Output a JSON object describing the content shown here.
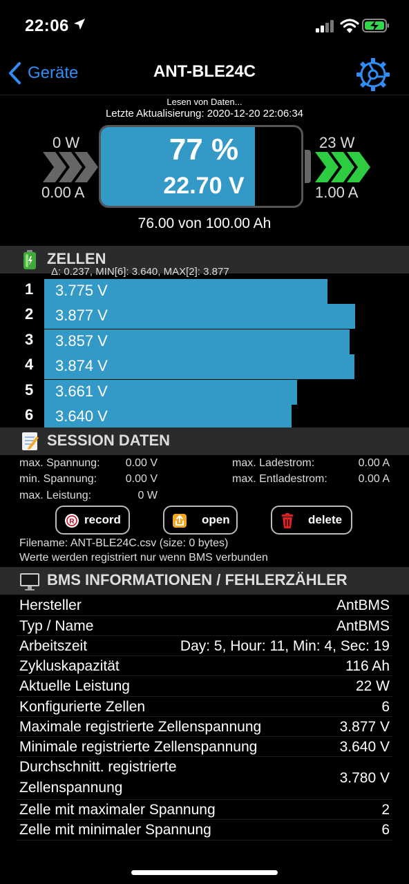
{
  "status_bar": {
    "time": "22:06"
  },
  "nav": {
    "back_label": "Geräte",
    "title": "ANT-BLE24C"
  },
  "battery": {
    "status": "Lesen von Daten...",
    "last_update": "Letzte Aktualisierung: 2020-12-20 22:06:34",
    "in_watts": "0 W",
    "in_amps": "0.00 A",
    "out_watts": "23 W",
    "out_amps": "1.00 A",
    "soc": "77 %",
    "soc_fraction": 0.77,
    "voltage": "22.70 V",
    "capacity": "76.00 von 100.00 Ah",
    "colors": {
      "fill": "#3399c6",
      "arrow_active": "#2ecc40",
      "arrow_inactive": "#666666"
    }
  },
  "cells": {
    "title": "ZELLEN",
    "summary": "Δ: 0.237, MIN[6]: 3.640, MAX[2]: 3.877",
    "items": [
      {
        "index": "1",
        "value": "3.775 V",
        "voltage": 3.775
      },
      {
        "index": "2",
        "value": "3.877 V",
        "voltage": 3.877
      },
      {
        "index": "3",
        "value": "3.857 V",
        "voltage": 3.857
      },
      {
        "index": "4",
        "value": "3.874 V",
        "voltage": 3.874
      },
      {
        "index": "5",
        "value": "3.661 V",
        "voltage": 3.661
      },
      {
        "index": "6",
        "value": "3.640 V",
        "voltage": 3.64
      }
    ]
  },
  "session": {
    "title": "SESSION DATEN",
    "max_voltage_label": "max. Spannung:",
    "max_voltage_value": "0.00 V",
    "min_voltage_label": "min. Spannung:",
    "min_voltage_value": "0.00 V",
    "max_power_label": "max. Leistung:",
    "max_power_value": "0 W",
    "max_charge_label": "max. Ladestrom:",
    "max_charge_value": "0.00 A",
    "max_discharge_label": "max. Entladestrom:",
    "max_discharge_value": "0.00 A",
    "record_label": "record",
    "open_label": "open",
    "delete_label": "delete",
    "filename": "Filename: ANT-BLE24C.csv (size: 0 bytes)",
    "note": "Werte werden registriert nur wenn BMS verbunden"
  },
  "info": {
    "title": "BMS INFORMATIONEN / FEHLERZÄHLER",
    "rows": [
      {
        "label": "Hersteller",
        "value": "AntBMS"
      },
      {
        "label": "Typ / Name",
        "value": "AntBMS"
      },
      {
        "label": "Arbeitszeit",
        "value": "Day: 5, Hour: 11, Min: 4, Sec: 19"
      },
      {
        "label": "Zykluskapazität",
        "value": "116 Ah"
      },
      {
        "label": "Aktuelle Leistung",
        "value": "22 W"
      },
      {
        "label": "Konfigurierte Zellen",
        "value": "6"
      },
      {
        "label": "Maximale registrierte Zellenspannung",
        "value": "3.877 V"
      },
      {
        "label": "Minimale registrierte Zellenspannung",
        "value": "3.640 V"
      },
      {
        "label": "Durchschnitt. registrierte",
        "label2": "Zellenspannung",
        "value": "3.780 V"
      },
      {
        "label": "Zelle mit maximaler Spannung",
        "value": "2"
      },
      {
        "label": "Zelle mit minimaler Spannung",
        "value": "6"
      }
    ]
  }
}
